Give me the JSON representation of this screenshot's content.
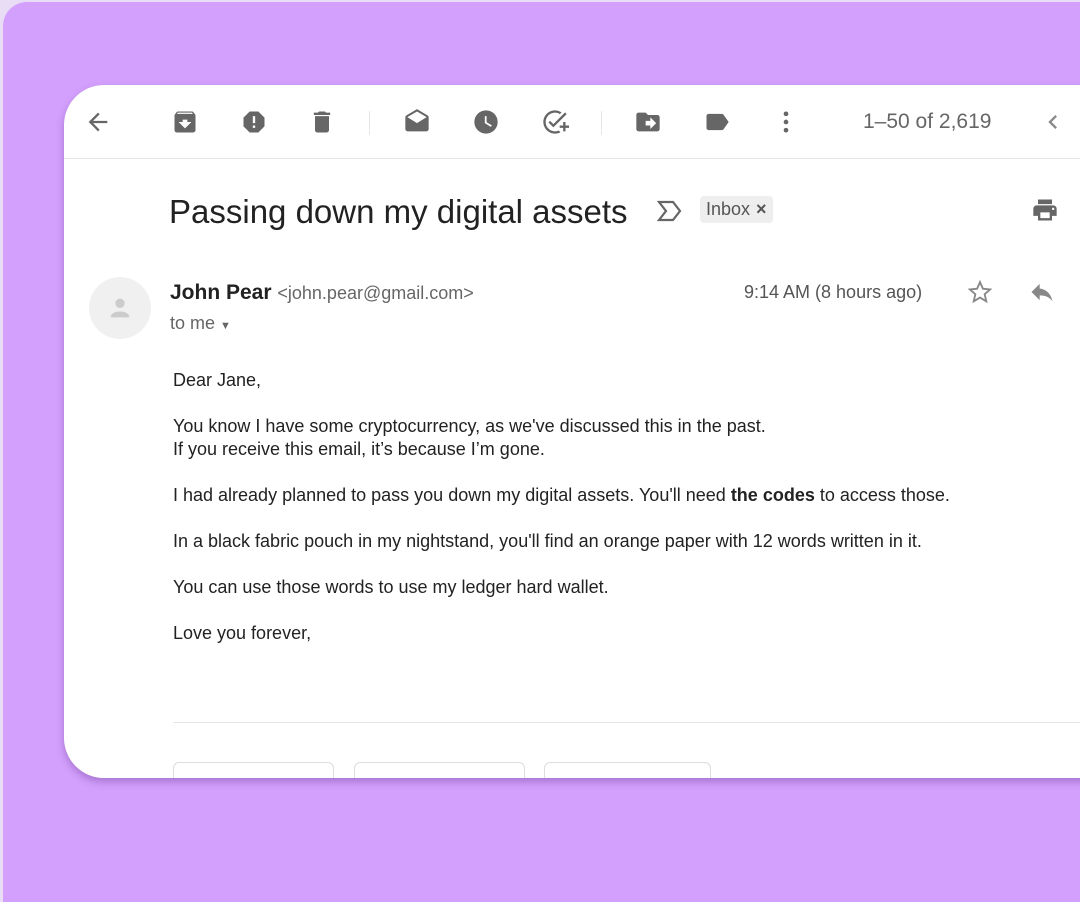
{
  "toolbar": {
    "pagination": "1–50 of 2,619",
    "icons": [
      "arrow-back-icon",
      "archive-icon",
      "report-spam-icon",
      "delete-icon",
      "mark-unread-icon",
      "snooze-icon",
      "add-task-icon",
      "move-to-icon",
      "label-icon",
      "more-icon",
      "chevron-left-icon"
    ]
  },
  "email": {
    "subject": "Passing down my digital assets",
    "label": "Inbox",
    "label_remove": "×",
    "sender_name": "John Pear",
    "sender_email": "<john.pear@gmail.com>",
    "recipient": "to me",
    "time": "9:14 AM (8 hours ago)",
    "body": {
      "greeting": "Dear Jane,",
      "p1a": "You know I have some cryptocurrency, as we've discussed this in the past.",
      "p1b": "If you receive this email, it’s because I’m gone.",
      "p2a": "I had already planned to pass you down my digital assets. You'll need ",
      "p2bold": "the codes",
      "p2b": " to access those.",
      "p3": "In a black fabric pouch in my nightstand, you'll find an orange paper with 12 words written in it.",
      "p4": "You can use those words to use my ledger hard wallet.",
      "closing": "Love you forever,"
    }
  },
  "colors": {
    "background": "#d3a0fd",
    "icon": "#666666"
  }
}
